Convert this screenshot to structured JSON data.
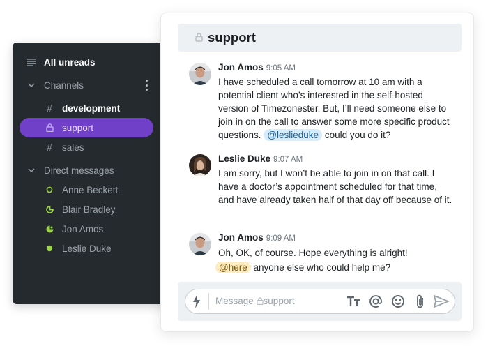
{
  "sidebar": {
    "all_unreads": "All unreads",
    "channels_label": "Channels",
    "channels": [
      {
        "name": "development",
        "icon": "hash-icon",
        "bold": true
      },
      {
        "name": "support",
        "icon": "lock-icon",
        "active": true
      },
      {
        "name": "sales",
        "icon": "hash-icon"
      }
    ],
    "dm_label": "Direct messages",
    "direct_messages": [
      {
        "name": "Anne Beckett",
        "status": "offline"
      },
      {
        "name": "Blair Bradley",
        "status": "away"
      },
      {
        "name": "Jon Amos",
        "status": "busy"
      },
      {
        "name": "Leslie Duke",
        "status": "online"
      }
    ]
  },
  "chat": {
    "channel_title": "support",
    "messages": [
      {
        "author": "Jon Amos",
        "time": "9:05 AM",
        "text": "I have scheduled a call tomorrow at 10 am with a potential client who’s interested in the self-hosted version of Timezonester. But, I’ll need someone else to join in on the call to answer some more specific product questions.",
        "mention": "@leslieduke",
        "after_mention": " could you do it?"
      },
      {
        "author": "Leslie Duke",
        "time": "9:07 AM",
        "text": "I am sorry, but I won’t be able to join in on that call. I have a doctor’s appointment scheduled for that time, and have already taken half of that day off because of it."
      },
      {
        "author": "Jon Amos",
        "time": "9:09 AM",
        "text": "Oh, OK, of course. Hope everything is alright!",
        "mention": "@here",
        "after_mention": " anyone else who could help me?"
      }
    ],
    "composer": {
      "placeholder_prefix": "Message",
      "placeholder_channel": "support"
    }
  },
  "colors": {
    "sidebar_bg": "#252a2f",
    "active_channel": "#7140c8",
    "status_green": "#9bd34a",
    "mention_blue_bg": "#d6ecfb",
    "mention_here_bg": "#fdecbf"
  }
}
